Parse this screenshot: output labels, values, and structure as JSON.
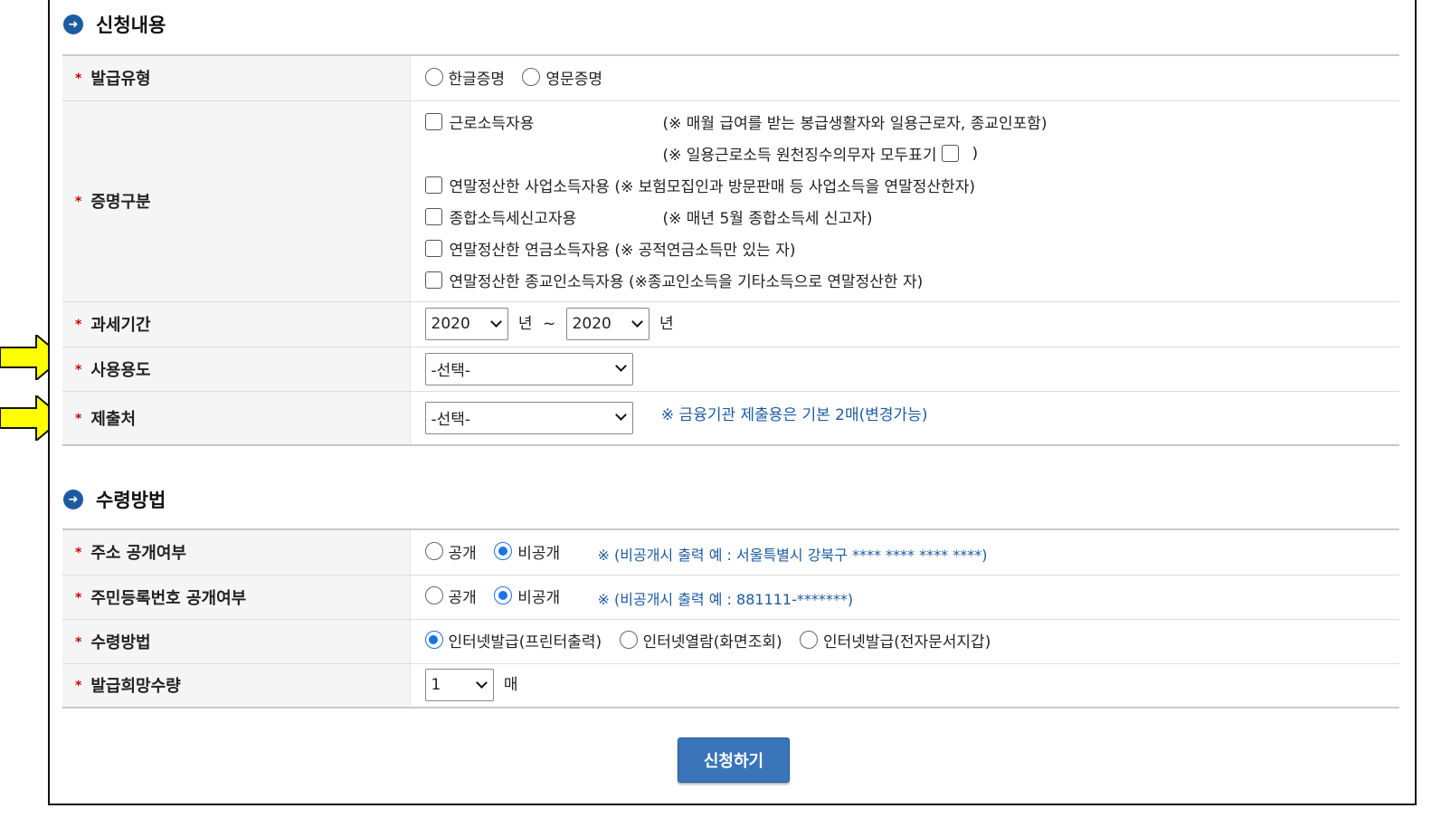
{
  "section1": {
    "title": "신청내용",
    "issue_type": {
      "label": "발급유형",
      "options": [
        "한글증명",
        "영문증명"
      ]
    },
    "cert_type": {
      "label": "증명구분",
      "row1_label": "근로소득자용",
      "row1_note": "(※ 매월 급여를 받는 봉급생활자와 일용근로자, 종교인포함)",
      "row1b_note": "(※ 일용근로소득 원천징수의무자 모두표기",
      "row1b_close": ")",
      "row2_label": "연말정산한 사업소득자용",
      "row2_note": "(※ 보험모집인과 방문판매 등 사업소득을 연말정산한자)",
      "row3_label": "종합소득세신고자용",
      "row3_note": "(※ 매년 5월 종합소득세 신고자)",
      "row4_label": "연말정산한 연금소득자용",
      "row4_note": "(※ 공적연금소득만 있는 자)",
      "row5_label": "연말정산한 종교인소득자용",
      "row5_note": "(※종교인소득을 기타소득으로 연말정산한 자)"
    },
    "tax_period": {
      "label": "과세기간",
      "from": "2020",
      "year_unit": "년",
      "tilde": "~",
      "to": "2020"
    },
    "usage": {
      "label": "사용용도",
      "selected": "-선택-"
    },
    "submit_to": {
      "label": "제출처",
      "selected": "-선택-",
      "note": "※ 금융기관 제출용은 기본 2매(변경가능)"
    }
  },
  "section2": {
    "title": "수령방법",
    "address_disclosure": {
      "label": "주소 공개여부",
      "opt_public": "공개",
      "opt_private": "비공개",
      "note": "※ (비공개시 출력 예 : 서울특별시 강북구 **** **** **** ****)"
    },
    "rrn_disclosure": {
      "label": "주민등록번호 공개여부",
      "opt_public": "공개",
      "opt_private": "비공개",
      "note": "※ (비공개시 출력 예 : 881111-*******)"
    },
    "receive_method": {
      "label": "수령방법",
      "options": [
        "인터넷발급(프린터출력)",
        "인터넷열람(화면조회)",
        "인터넷발급(전자문서지갑)"
      ]
    },
    "quantity": {
      "label": "발급희망수량",
      "selected": "1",
      "unit": "매"
    }
  },
  "submit_button": "신청하기",
  "colors": {
    "accent_blue": "#1d5ba0",
    "button_blue": "#3a75ba",
    "arrow_yellow": "#ffff00",
    "required_red": "#cc0000"
  }
}
